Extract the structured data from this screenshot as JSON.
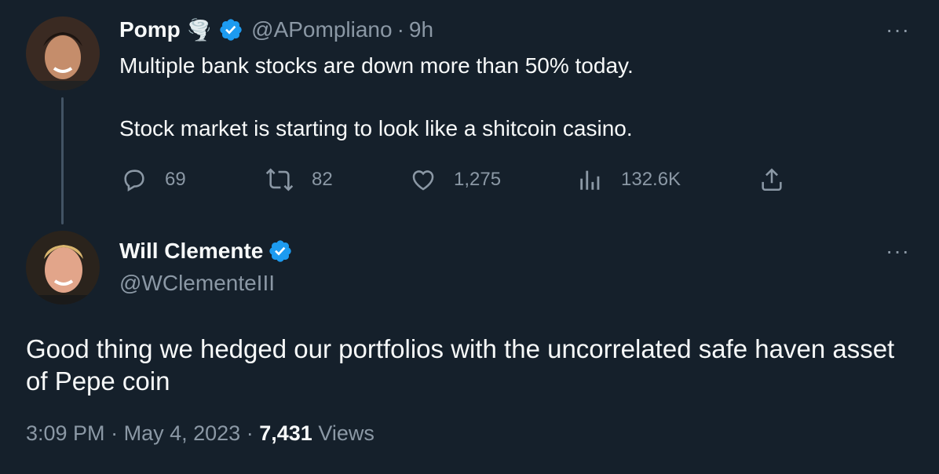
{
  "parent_tweet": {
    "name": "Pomp",
    "name_emoji": "🌪️",
    "handle": "@APompliano",
    "separator": "·",
    "time": "9h",
    "text_line1": "Multiple bank stocks are down more than 50% today.",
    "text_line2": "Stock market is starting to look like a shitcoin casino.",
    "more": "···",
    "actions": {
      "replies": "69",
      "retweets": "82",
      "likes": "1,275",
      "views": "132.6K"
    }
  },
  "main_tweet": {
    "name": "Will Clemente",
    "handle": "@WClementeIII",
    "more": "···",
    "text": "Good thing we hedged our portfolios with the uncorrelated safe haven asset of Pepe coin",
    "time": "3:09 PM",
    "sep1": "·",
    "date": "May 4, 2023",
    "sep2": "·",
    "views_count": "7,431",
    "views_label": "Views"
  },
  "colors": {
    "background": "#15202b",
    "text": "#f7f9f9",
    "muted": "#8b98a5",
    "verified": "#1d9bf0"
  }
}
